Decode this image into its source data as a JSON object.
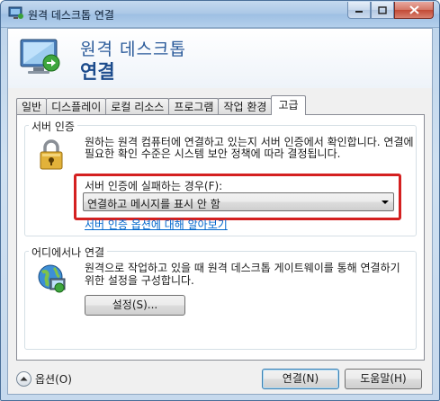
{
  "window": {
    "title": "원격 데스크톱 연결",
    "icon": "remote-desktop-icon"
  },
  "header": {
    "title_line1": "원격 데스크톱",
    "title_line2": "연결"
  },
  "tabs": [
    {
      "label": "일반",
      "active": false
    },
    {
      "label": "디스플레이",
      "active": false
    },
    {
      "label": "로컬 리소스",
      "active": false
    },
    {
      "label": "프로그램",
      "active": false
    },
    {
      "label": "작업 환경",
      "active": false
    },
    {
      "label": "고급",
      "active": true
    }
  ],
  "server_auth": {
    "group_label": "서버 인증",
    "description": "원하는 원격 컴퓨터에 연결하고 있는지 서버 인증에서 확인합니다. 연결에 필요한 확인 수준은 시스템 보안 정책에 따라 결정됩니다.",
    "fail_label": "서버 인증에 실패하는 경우(F):",
    "dropdown_value": "연결하고 메시지를 표시 안 함",
    "link": "서버 인증 옵션에 대해 알아보기",
    "highlight_color": "#d42020"
  },
  "anywhere": {
    "group_label": "어디에서나 연결",
    "description": "원격으로 작업하고 있을 때 원격 데스크톱 게이트웨이를 통해 연결하기 위한 설정을 구성합니다.",
    "settings_button": "설정(S)..."
  },
  "footer": {
    "options_button": "옵션(O)",
    "connect_button": "연결(N)",
    "help_button": "도움말(H)"
  }
}
